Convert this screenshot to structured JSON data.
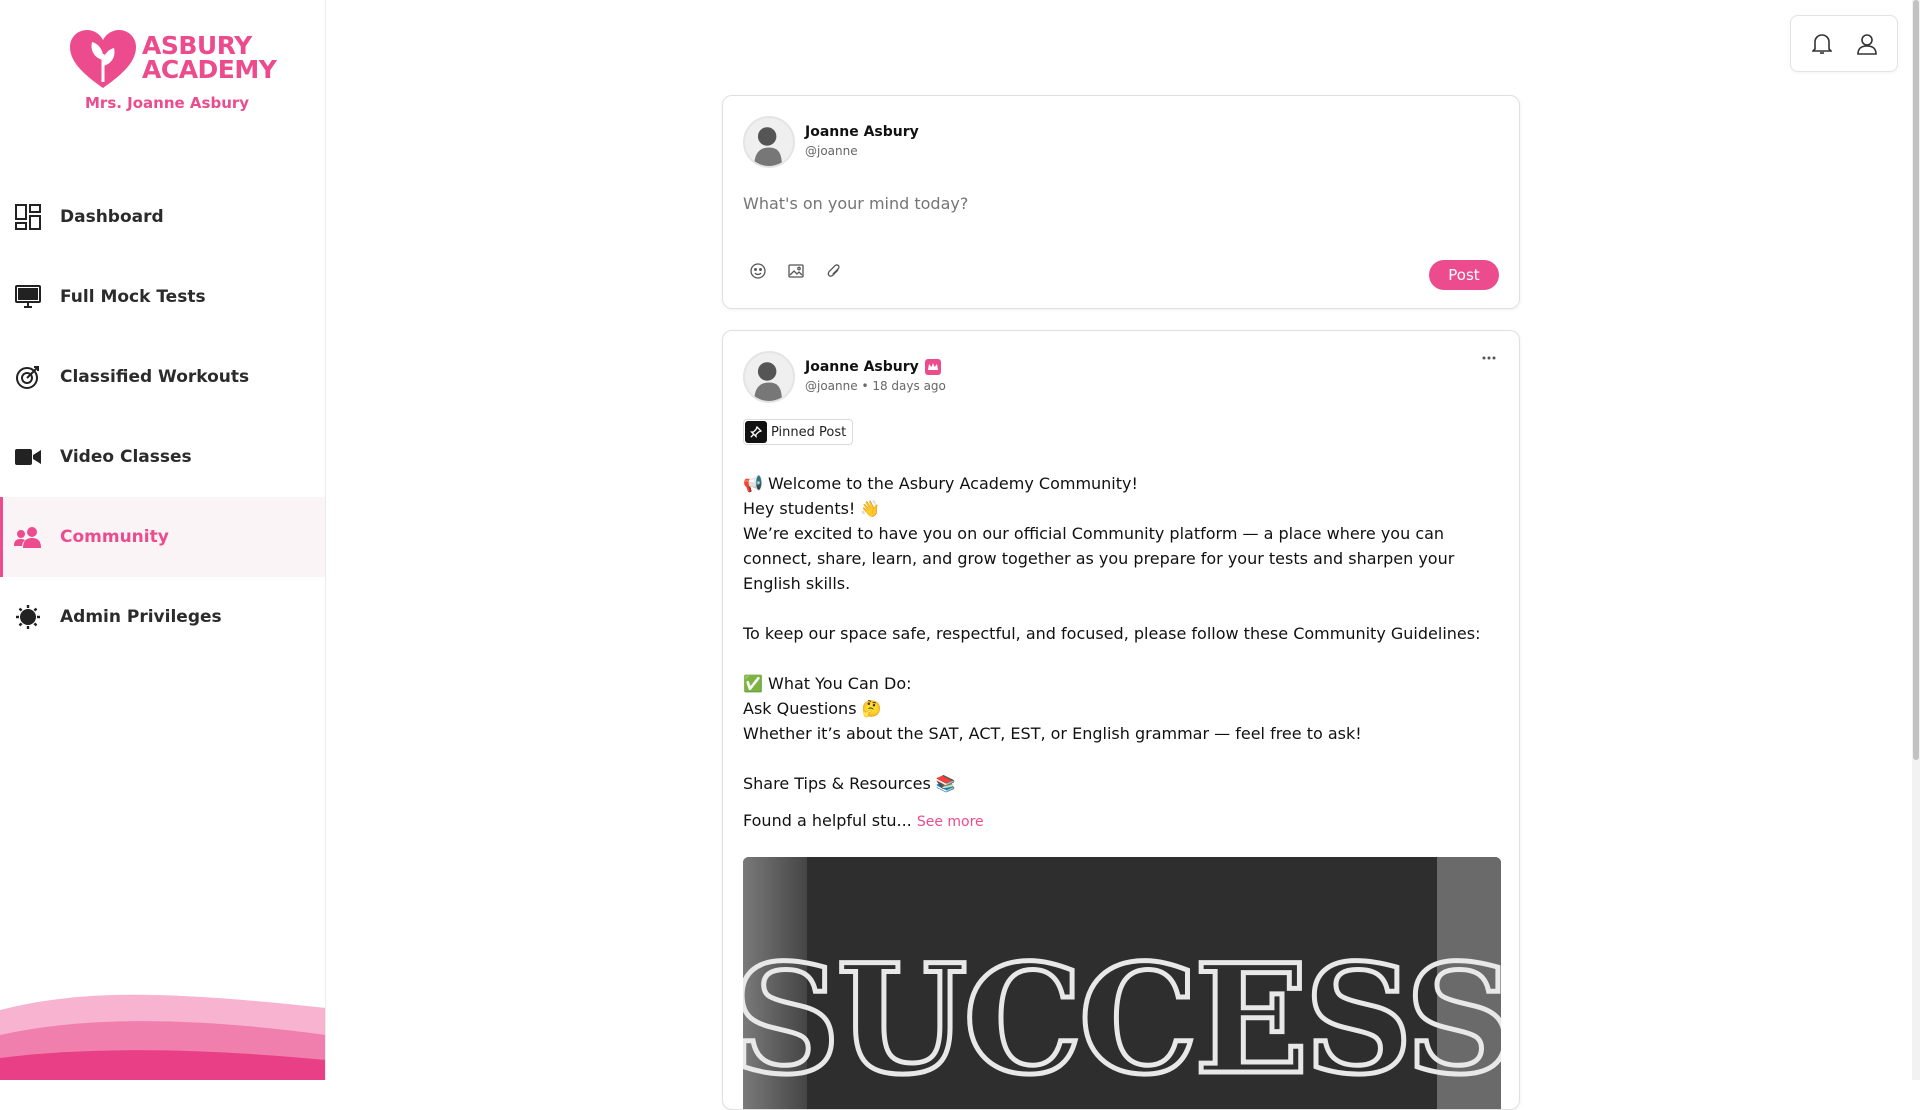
{
  "brand": {
    "name_line1": "ASBURY",
    "name_line2": "ACADEMY",
    "owner": "Mrs. Joanne Asbury",
    "accent_color": "#ec4c8e"
  },
  "sidebar": {
    "items": [
      {
        "label": "Dashboard",
        "icon": "dashboard-icon",
        "active": false
      },
      {
        "label": "Full Mock Tests",
        "icon": "monitor-icon",
        "active": false
      },
      {
        "label": "Classified Workouts",
        "icon": "target-icon",
        "active": false
      },
      {
        "label": "Video Classes",
        "icon": "video-camera-icon",
        "active": false
      },
      {
        "label": "Community",
        "icon": "community-icon",
        "active": true
      },
      {
        "label": "Admin Privileges",
        "icon": "admin-gear-icon",
        "active": false
      }
    ]
  },
  "topbar": {
    "icons": [
      "bell-icon",
      "user-icon"
    ]
  },
  "composer": {
    "author_name": "Joanne Asbury",
    "author_handle": "@joanne",
    "placeholder": "What's on your mind today?",
    "tools": [
      "emoji-icon",
      "image-icon",
      "attachment-icon"
    ],
    "post_label": "Post"
  },
  "post": {
    "author_name": "Joanne Asbury",
    "author_handle": "@joanne",
    "timestamp": "• 18 days ago",
    "pinned_label": "Pinned Post",
    "lines": [
      "📢 Welcome to the Asbury Academy Community!",
      "Hey students! 👋",
      "We’re excited to have you on our official Community platform — a place where you can connect, share, learn, and grow together as you prepare for your tests and sharpen your English skills.",
      "",
      "To keep our space safe, respectful, and focused, please follow these Community Guidelines:",
      "",
      "✅ What You Can Do:",
      "Ask Questions 🤔",
      "Whether it’s about the SAT, ACT, EST, or English grammar — feel free to ask!",
      "",
      "Share Tips & Resources 📚"
    ],
    "truncated_text": "Found a helpful stu...",
    "see_more_label": "See more",
    "image_text": "SUCCESS"
  }
}
